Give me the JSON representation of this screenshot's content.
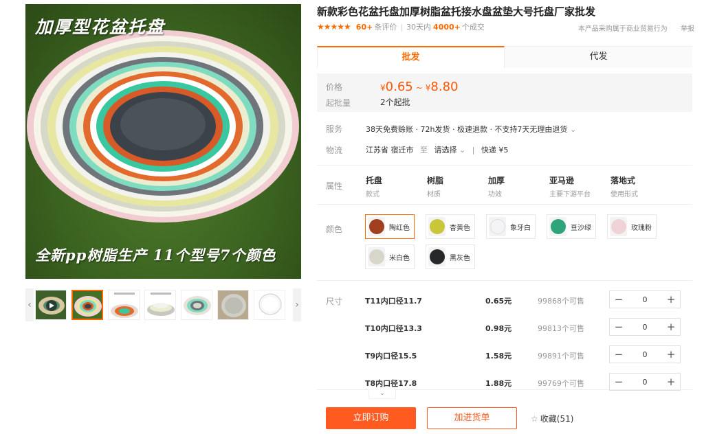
{
  "gallery": {
    "overlay_top": "加厚型花盆托盘",
    "overlay_bottom": "全新pp树脂生产  11个型号7个颜色",
    "prev_arrow": "‹",
    "next_arrow": "›"
  },
  "product": {
    "title": "新款彩色花盆托盘加厚树脂盆托接水盘盆垫大号托盘厂家批发",
    "stars": "★★★★★",
    "review_count": "60+",
    "review_label": "条评价",
    "sales_prefix": "30天内",
    "sales_count": "4000+",
    "sales_suffix": "个成交",
    "notice": "本产品采购属于商业贸易行为",
    "report": "举报"
  },
  "tabs": [
    "批发",
    "代发"
  ],
  "pricing": {
    "price_label": "价格",
    "currency": "¥",
    "price_min": "0.65",
    "tilde": "~",
    "price_max": "8.80",
    "moq_label": "起批量",
    "moq": "2个起批"
  },
  "service": {
    "label": "服务",
    "text": "38天免费赊账 · 72h发货 · 极速退款 · 不支持7天无理由退货",
    "chevron": "⌄"
  },
  "logistics": {
    "label": "物流",
    "origin": "江苏省 宿迁市",
    "to": "至",
    "select": "请选择",
    "chevron": "⌄",
    "sep": "|",
    "shipping": "快递 ¥5"
  },
  "attributes": {
    "label": "属性",
    "items": [
      {
        "name": "托盘",
        "sub": "款式"
      },
      {
        "name": "树脂",
        "sub": "材质"
      },
      {
        "name": "加厚",
        "sub": "功效"
      },
      {
        "name": "亚马逊",
        "sub": "主要下游平台"
      },
      {
        "name": "落地式",
        "sub": "使用形式"
      }
    ]
  },
  "colors": {
    "label": "颜色",
    "options": [
      {
        "name": "陶红色",
        "hex": "#a0401e"
      },
      {
        "name": "杏黄色",
        "hex": "#c9c63a"
      },
      {
        "name": "象牙白",
        "hex": "#f4f4f6"
      },
      {
        "name": "豆沙绿",
        "hex": "#2fa37a"
      },
      {
        "name": "玫瑰粉",
        "hex": "#f0d3d6"
      },
      {
        "name": "米白色",
        "hex": "#d8d5c9"
      },
      {
        "name": "黑灰色",
        "hex": "#262829"
      }
    ]
  },
  "sizes": {
    "label": "尺寸",
    "rows": [
      {
        "name": "T11内口径11.7",
        "price": "0.65元",
        "stock": "99868个可售",
        "qty": "0"
      },
      {
        "name": "T10内口径13.3",
        "price": "0.98元",
        "stock": "99813个可售",
        "qty": "0"
      },
      {
        "name": "T9内口径15.5",
        "price": "1.58元",
        "stock": "99891个可售",
        "qty": "0"
      },
      {
        "name": "T8内口径17.8",
        "price": "1.88元",
        "stock": "99769个可售",
        "qty": "0"
      }
    ],
    "minus": "−",
    "plus": "+",
    "more_chevron": "⌄"
  },
  "actions": {
    "order": "立即订购",
    "cart": "加进货单",
    "fav_icon": "☆",
    "fav": "收藏(51)"
  }
}
